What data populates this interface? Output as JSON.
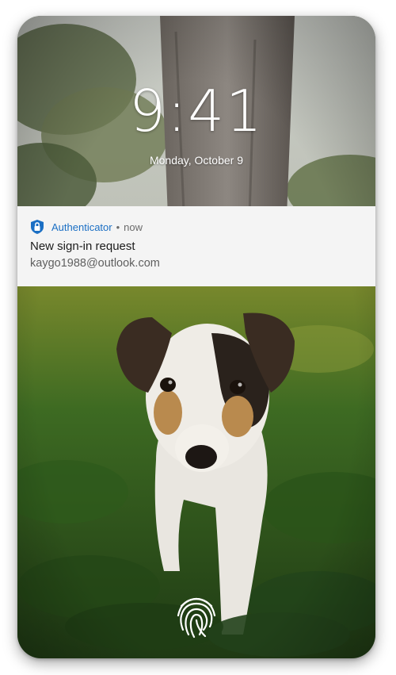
{
  "lock_screen": {
    "time": "9:41",
    "date": "Monday, October 9"
  },
  "notification": {
    "app_name": "Authenticator",
    "separator": "•",
    "time": "now",
    "title": "New sign-in request",
    "body": "kaygo1988@outlook.com",
    "app_icon": "lock-shield-icon",
    "accent_color": "#1b6fc4"
  },
  "unlock": {
    "icon": "fingerprint-icon"
  },
  "wallpaper": {
    "subject": "dog-in-grass-photo"
  }
}
